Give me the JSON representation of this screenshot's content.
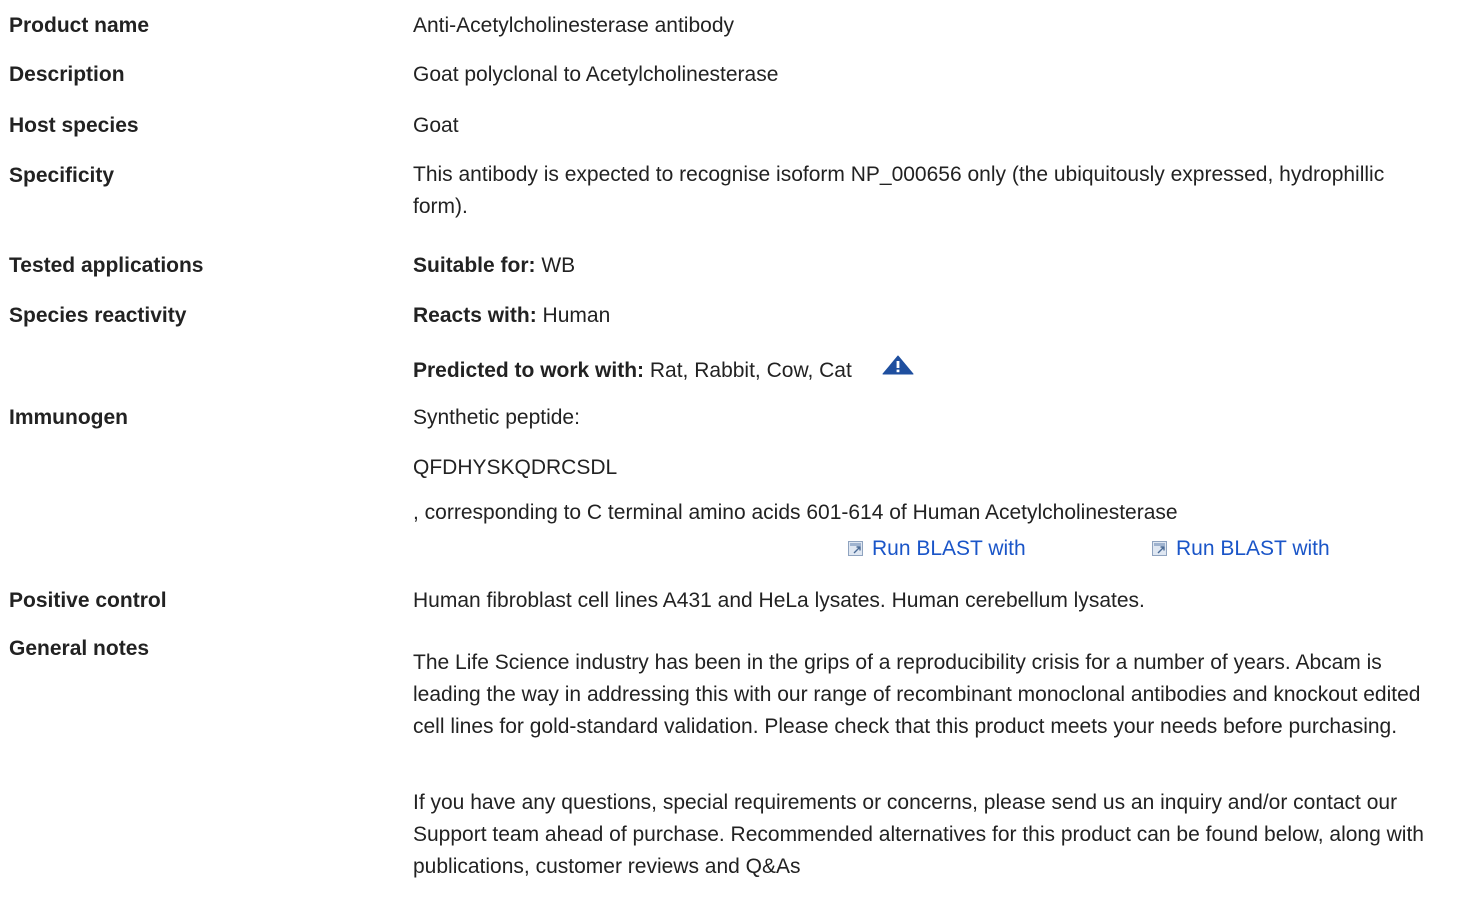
{
  "rows": {
    "product_name": {
      "label": "Product name",
      "value": "Anti-Acetylcholinesterase antibody"
    },
    "description": {
      "label": "Description",
      "value": "Goat polyclonal to Acetylcholinesterase"
    },
    "host_species": {
      "label": "Host species",
      "value": "Goat"
    },
    "specificity": {
      "label": "Specificity",
      "value": "This antibody is expected to recognise isoform NP_000656 only (the ubiquitously expressed, hydrophillic form)."
    },
    "tested_applications": {
      "label": "Tested applications",
      "prefix": "Suitable for:",
      "value": "WB"
    },
    "species_reactivity": {
      "label": "Species reactivity",
      "reacts_prefix": "Reacts with:",
      "reacts_value": "Human",
      "predicted_prefix": "Predicted to work with:",
      "predicted_value": "Rat, Rabbit, Cow, Cat",
      "warning_icon": "warning-triangle-icon"
    },
    "immunogen": {
      "label": "Immunogen",
      "line1": "Synthetic peptide:",
      "sequence": "QFDHYSKQDRCSDL",
      "line3": ", corresponding to C terminal amino acids 601-614 of Human Acetylcholinesterase",
      "blast_links": [
        "Run BLAST with",
        "Run BLAST with"
      ],
      "blast_icon": "external-link-icon"
    },
    "positive_control": {
      "label": "Positive control",
      "value": "Human fibroblast cell lines A431 and HeLa lysates. Human cerebellum lysates."
    },
    "general_notes": {
      "label": "General notes",
      "para1": "The Life Science industry has been in the grips of a reproducibility crisis for a number of years. Abcam is leading the way in addressing this with our range of recombinant monoclonal antibodies and knockout edited cell lines for gold-standard validation. Please check that this product meets your needs before purchasing.",
      "para2": "If you have any questions, special requirements or concerns, please send us an inquiry and/or contact our Support team ahead of purchase. Recommended alternatives for this product can be found below, along with publications, customer reviews and Q&As"
    }
  },
  "colors": {
    "text": "#222222",
    "link": "#1a55c8",
    "warning_icon": "#1f4f9f"
  }
}
